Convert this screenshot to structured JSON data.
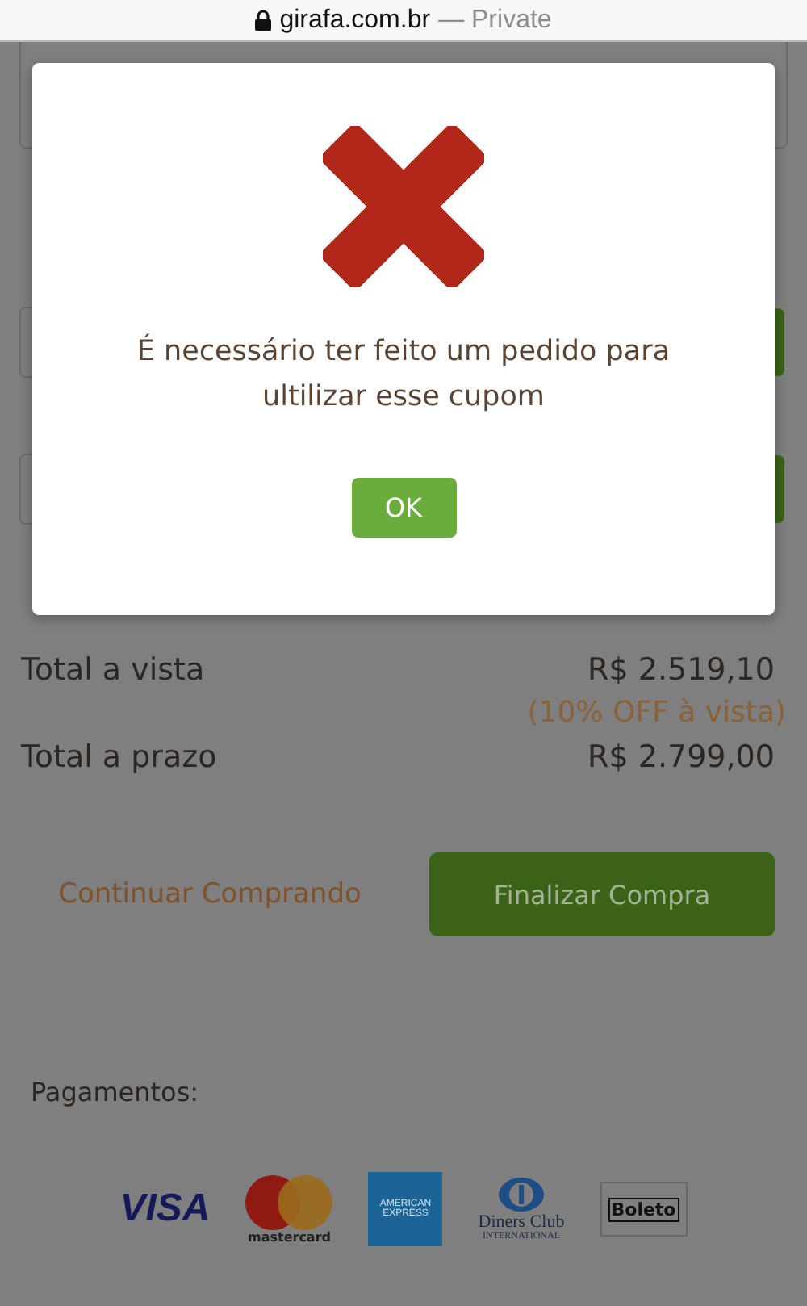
{
  "address_bar": {
    "domain": "girafa.com.br",
    "mode": "— Private"
  },
  "totals": [
    {
      "label": "Total a vista",
      "value": "R$ 2.519,10",
      "note": "(10% OFF à vista)"
    },
    {
      "label": "Total a prazo",
      "value": "R$ 2.799,00"
    }
  ],
  "actions": {
    "continue_link": "Continuar Comprando",
    "checkout_button": "Finalizar Compra"
  },
  "payments": {
    "title": "Pagamentos:",
    "methods": [
      {
        "kind": "visa",
        "texts": [
          "VISA"
        ]
      },
      {
        "kind": "mastercard",
        "texts": [
          "mastercard"
        ]
      },
      {
        "kind": "amex",
        "texts": [
          "AMERICAN",
          "EXPRESS"
        ]
      },
      {
        "kind": "diners",
        "texts": [
          "Diners Club",
          "INTERNATIONAL"
        ]
      },
      {
        "kind": "boleto",
        "texts": [
          "Boleto"
        ]
      }
    ]
  },
  "dialog": {
    "message": "É necessário ter feito um pedido para ultilizar esse cupom",
    "button": "OK"
  }
}
